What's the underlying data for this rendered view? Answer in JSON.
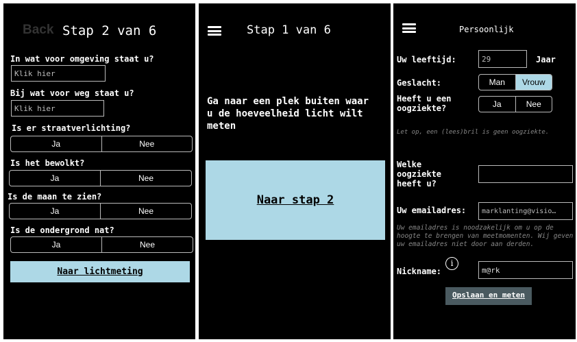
{
  "screen1": {
    "back_label": "Back",
    "step_label": "Stap 2 van 6",
    "q1": "In wat voor omgeving staat u?",
    "q1_placeholder": "Klik hier",
    "q2": "Bij wat voor weg staat u?",
    "q2_placeholder": "Klik hier",
    "q3": "Is er straatverlichting?",
    "q4": "Is het bewolkt?",
    "q5": "Is de maan te zien?",
    "q6": "Is de ondergrond nat?",
    "yes": "Ja",
    "no": "Nee",
    "cta": "Naar lichtmeting"
  },
  "screen2": {
    "step_label": "Stap 1 van 6",
    "instruction": "Ga naar een plek buiten waar u de hoeveelheid licht wilt meten",
    "cta": "Naar stap 2"
  },
  "screen3": {
    "title": "Persoonlijk",
    "age_label": "Uw leeftijd:",
    "age_value": "29",
    "age_unit": "Jaar",
    "gender_label": "Geslacht:",
    "gender_male": "Man",
    "gender_female": "Vrouw",
    "eye_q": "Heeft u een oogziekte?",
    "yes": "Ja",
    "no": "Nee",
    "glasses_note": "Let op, een (lees)bril is geen oogziekte.",
    "which_eye": "Welke oogziekte heeft u?",
    "email_label": "Uw emailadres:",
    "email_value": "marklanting@visio…",
    "email_note": "Uw emailadres is noodzakelijk om u op de hoogte te brengen van meetmomenten. Wij geven uw emailadres niet door aan derden.",
    "nickname_label": "Nickname:",
    "info_icon_glyph": "i",
    "nickname_value": "m@rk",
    "save_button": "Opslaan en meten"
  },
  "colors": {
    "accent": "#add8e6",
    "background": "#000000"
  }
}
